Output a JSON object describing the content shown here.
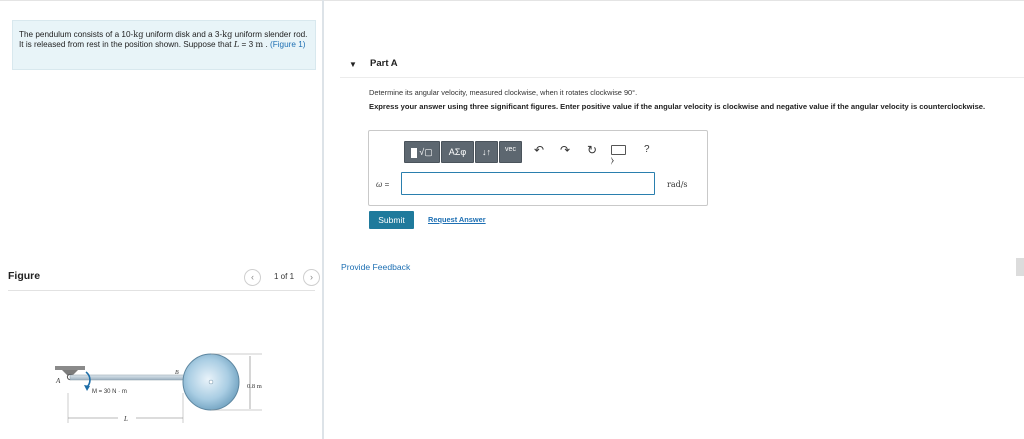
{
  "problem": {
    "text_before": "The pendulum consists of a 10-",
    "unit_kg1": "kg",
    "text_mid1": " uniform disk and a 3-",
    "unit_kg2": "kg",
    "text_mid2": " uniform slender rod. It is released from rest in the position shown. Suppose that ",
    "var_L": "L",
    "eq": " = 3 ",
    "unit_m": "m",
    "text_end": " . ",
    "figure_link": "(Figure 1)"
  },
  "figure_panel": {
    "title": "Figure",
    "prev_icon": "chevron-left-icon",
    "next_icon": "chevron-right-icon",
    "page_count": "1 of 1",
    "labels": {
      "point_a": "A",
      "point_b": "B",
      "moment": "M = 30 N · m",
      "diameter": "0.8 m",
      "length": "L"
    }
  },
  "part": {
    "caret_icon": "caret-down-icon",
    "title": "Part A",
    "question": "Determine its angular velocity, measured clockwise, when it rotates clockwise 90°.",
    "instruction": "Express your answer using three significant figures. Enter positive value if the angular velocity is clockwise and negative value if the angular velocity is counterclockwise.",
    "toolbar": {
      "template_icon": "template-icon",
      "sqrt_label": "√▢",
      "greek_label": "ΑΣφ",
      "arrows_label": "↓↑",
      "vec_label": "vec",
      "undo_icon": "undo-icon",
      "redo_icon": "redo-icon",
      "reset_icon": "reset-icon",
      "keyboard_icon": "keyboard-icon",
      "help_label": "?"
    },
    "answer_label": "ω =",
    "answer_value": "",
    "unit": "rad/s",
    "submit_label": "Submit",
    "request_label": "Request Answer"
  },
  "feedback_label": "Provide Feedback",
  "colors": {
    "accent": "#1f7a9c",
    "link": "#1d6fb3",
    "problem_bg": "#e8f4f8",
    "toolbar": "#5d6770"
  }
}
